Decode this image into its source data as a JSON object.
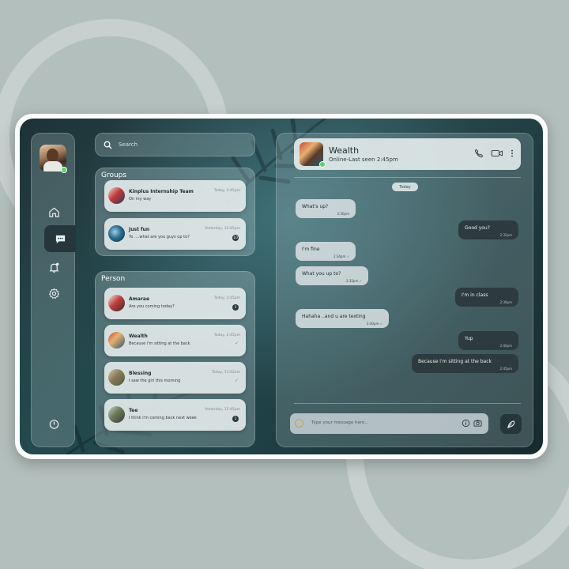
{
  "search": {
    "placeholder": "Search"
  },
  "groups": {
    "title": "Groups",
    "items": [
      {
        "name": "Kinplus Internship Team",
        "message": "On my way",
        "time": "Today, 2:45pm"
      },
      {
        "name": "Just fun",
        "message": "Yo ....what are you guys up to?",
        "time": "Yesterday, 12:45pm",
        "badge": "10"
      }
    ]
  },
  "persons": {
    "title": "Person",
    "items": [
      {
        "name": "Amarae",
        "message": "Are you coming today?",
        "time": "Today, 2:45pm",
        "badge": "1"
      },
      {
        "name": "Wealth",
        "message": "Because i'm sitting at the back",
        "time": "Today, 2:45pm",
        "tick": "✓"
      },
      {
        "name": "Blessing",
        "message": "I saw the girl this morning",
        "time": "Today, 11:02am",
        "tick": "✓"
      },
      {
        "name": "Tee",
        "message": "I think i'm coming back next week",
        "time": "Yesterday, 12:45pm",
        "badge": "1"
      }
    ]
  },
  "chat": {
    "name": "Wealth",
    "status": "Online-Last seen 2:45pm",
    "day": "Today",
    "messages": [
      {
        "dir": "in",
        "text": "What's up?",
        "time": "2:30pm"
      },
      {
        "dir": "out",
        "text": "Good you?",
        "time": "2:32pm"
      },
      {
        "dir": "in",
        "text": "I'm fine",
        "time": "2:34pm ✓"
      },
      {
        "dir": "in",
        "text": "What you up to?",
        "time": "2:35pm ✓"
      },
      {
        "dir": "out",
        "text": "I'm in class",
        "time": "2:36pm"
      },
      {
        "dir": "in",
        "text": "Hahaha ..and u are texting",
        "time": "2:40pm ✓"
      },
      {
        "dir": "out",
        "text": "Yup",
        "time": "2:40pm"
      },
      {
        "dir": "out",
        "text": "Because i'm sitting at the back",
        "time": "2:45pm"
      }
    ],
    "composer_placeholder": "Type your message here..."
  },
  "icons": {
    "home": "home-icon",
    "chat": "chat-icon",
    "notifications": "bell-icon",
    "settings": "gear-icon",
    "power": "power-icon",
    "phone": "phone-icon",
    "video": "video-icon",
    "more": "more-vertical-icon",
    "emoji": "emoji-icon",
    "attach": "info-icon",
    "camera": "camera-icon",
    "send": "send-icon"
  },
  "colors": {
    "accent_dark": "#25373a",
    "online": "#4cd964",
    "bubble_out": "#2e3b3e"
  }
}
